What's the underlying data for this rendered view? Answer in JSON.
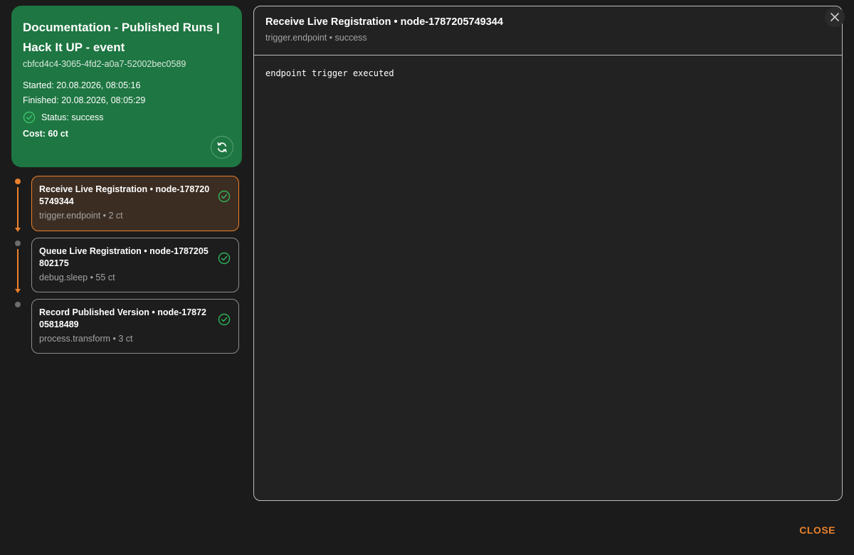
{
  "run": {
    "title": "Documentation - Published Runs | Hack It UP - event",
    "id": "cbfcd4c4-3065-4fd2-a0a7-52002bec0589",
    "started": "Started: 20.08.2026, 08:05:16",
    "finished": "Finished: 20.08.2026, 08:05:29",
    "status": "Status: success",
    "cost": "Cost: 60 ct",
    "refresh_icon": "refresh-icon"
  },
  "nodes": [
    {
      "title": "Receive Live Registration • node-1787205749344",
      "meta": "trigger.endpoint • 2 ct",
      "status_icon": "check-circle-icon",
      "selected": true
    },
    {
      "title": "Queue Live Registration • node-1787205802175",
      "meta": "debug.sleep • 55 ct",
      "status_icon": "check-circle-icon",
      "selected": false
    },
    {
      "title": "Record Published Version • node-1787205818489",
      "meta": "process.transform • 3 ct",
      "status_icon": "check-circle-icon",
      "selected": false
    }
  ],
  "detail": {
    "title": "Receive Live Registration • node-1787205749344",
    "subtitle": "trigger.endpoint • success",
    "output": "endpoint trigger executed"
  },
  "actions": {
    "close_label": "CLOSE"
  },
  "colors": {
    "run_card_bg": "#1e7642",
    "accent": "#e9812d",
    "success": "#2fb55a",
    "background": "#1b1b1b"
  }
}
